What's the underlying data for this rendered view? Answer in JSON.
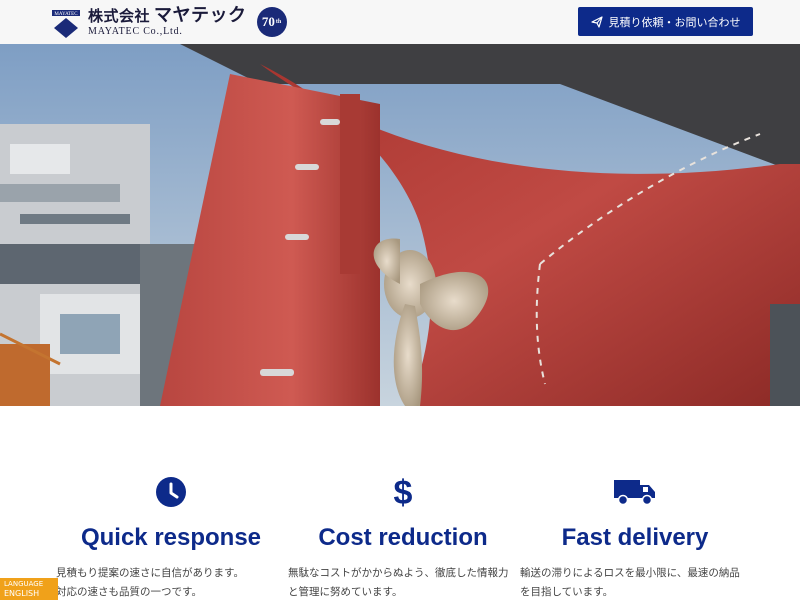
{
  "header": {
    "logo_mark_text": "MAYATEC",
    "logo_jp": "株式会社",
    "logo_kana": "マヤテック",
    "logo_en": "MAYATEC Co.,Ltd.",
    "anniversary_number": "70",
    "anniversary_suffix": "th",
    "cta_label": "見積り依頼・お問い合わせ"
  },
  "features": [
    {
      "icon": "clock-icon",
      "title": "Quick response",
      "lines": [
        "見積もり提案の速さに自信があります。",
        "対応の速さも品質の一つです。"
      ]
    },
    {
      "icon": "dollar-icon",
      "title": "Cost reduction",
      "lines": [
        "無駄なコストがかからぬよう、徹底した情報力",
        "と管理に努めています。"
      ]
    },
    {
      "icon": "truck-icon",
      "title": "Fast delivery",
      "lines": [
        "輸送の滞りによるロスを最小限に、最速の納品",
        "を目指しています。"
      ]
    }
  ],
  "language": {
    "label": "LANGUAGE",
    "current": "ENGLISH"
  },
  "colors": {
    "brand_navy": "#0d2a8a",
    "hull_red": "#b03a36",
    "lang_orange": "#f0a11a"
  }
}
